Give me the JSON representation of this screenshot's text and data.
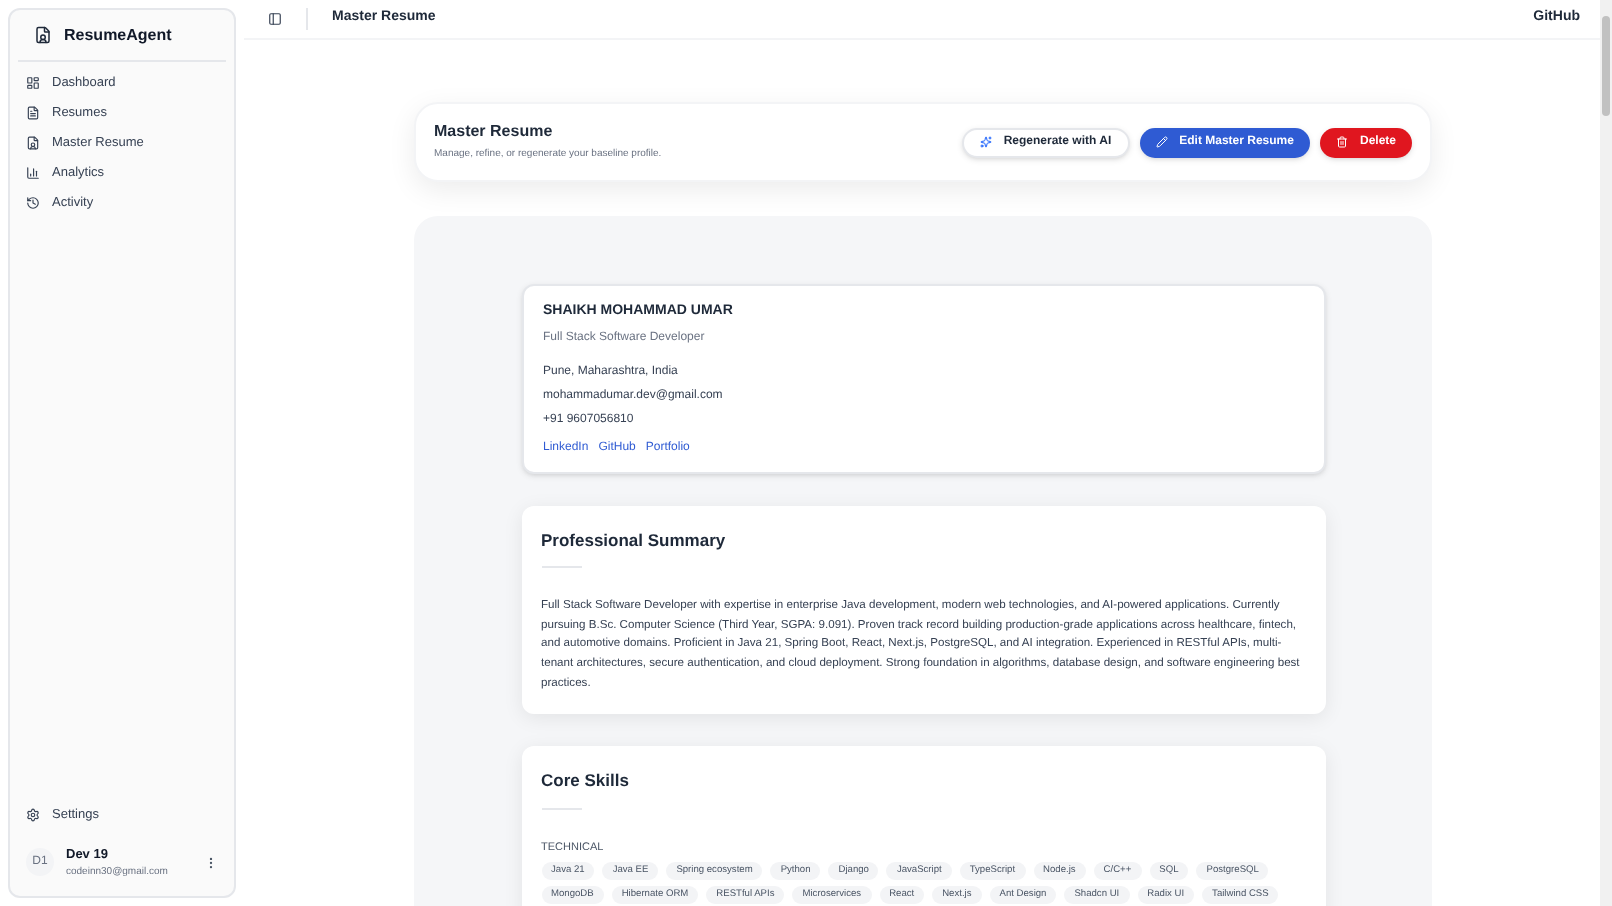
{
  "sidebar": {
    "brand": "ResumeAgent",
    "items": [
      {
        "label": "Dashboard"
      },
      {
        "label": "Resumes"
      },
      {
        "label": "Master Resume"
      },
      {
        "label": "Analytics"
      },
      {
        "label": "Activity"
      }
    ],
    "settings": "Settings",
    "user": {
      "initials": "D1",
      "name": "Dev 19",
      "email": "codeinn30@gmail.com"
    }
  },
  "header": {
    "title": "Master Resume",
    "link": "GitHub"
  },
  "page_card": {
    "title": "Master Resume",
    "subtitle": "Manage, refine, or regenerate your baseline profile.",
    "buttons": [
      {
        "label": "Regenerate with AI",
        "kind": "outline"
      },
      {
        "label": "Edit Master Resume",
        "kind": "primary"
      },
      {
        "label": "Delete",
        "kind": "danger"
      }
    ]
  },
  "profile": {
    "name": "SHAIKH MOHAMMAD UMAR",
    "role": "Full Stack Software Developer",
    "location": "Pune, Maharashtra, India",
    "email": "mohammadumar.dev@gmail.com",
    "phone": "+91 9607056810",
    "links": [
      "LinkedIn",
      "GitHub",
      "Portfolio"
    ]
  },
  "summary": {
    "title": "Professional Summary",
    "text": "Full Stack Software Developer with expertise in enterprise Java development, modern web technologies, and AI-powered applications. Currently pursuing B.Sc. Computer Science (Third Year, SGPA: 9.091). Proven track record building production-grade applications across healthcare, fintech, and automotive domains. Proficient in Java 21, Spring Boot, React, Next.js, PostgreSQL, and AI integration. Experienced in RESTful APIs, multi-tenant architectures, secure authentication, and cloud deployment. Strong foundation in algorithms, database design, and software engineering best practices."
  },
  "skills": {
    "title": "Core Skills",
    "group": "TECHNICAL",
    "tags": [
      "Java 21",
      "Java EE",
      "Spring ecosystem",
      "Python",
      "Django",
      "JavaScript",
      "TypeScript",
      "Node.js",
      "C/C++",
      "SQL",
      "PostgreSQL",
      "MongoDB",
      "Hibernate ORM",
      "RESTful APIs",
      "Microservices",
      "React",
      "Next.js",
      "Ant Design",
      "Shadcn UI",
      "Radix UI",
      "Tailwind CSS"
    ]
  }
}
